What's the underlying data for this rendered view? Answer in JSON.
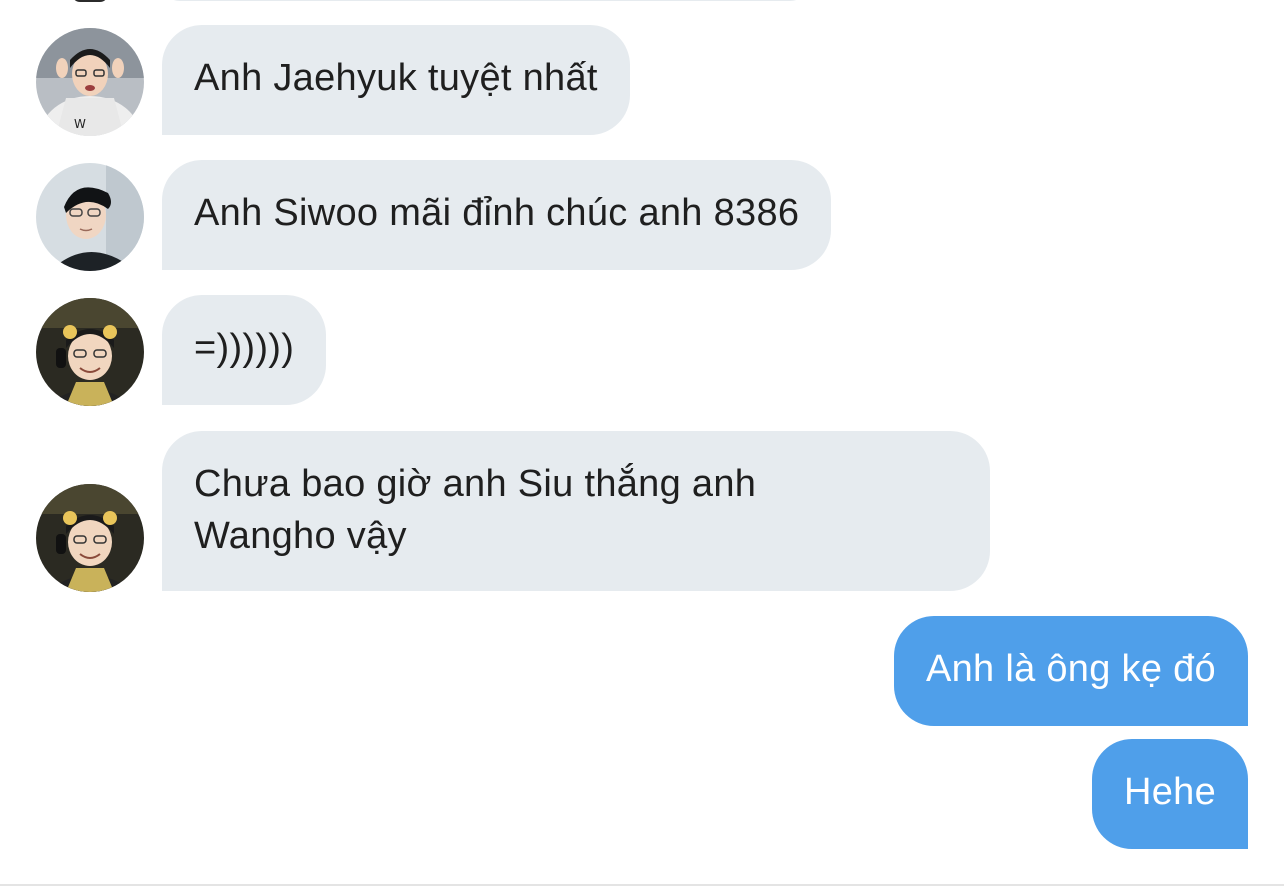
{
  "messages": [
    {
      "direction": "incoming",
      "sender_avatar": "avatar-jaehyuk",
      "text": "Anh Jaehyuk tuyệt nhất"
    },
    {
      "direction": "incoming",
      "sender_avatar": "avatar-siwoo",
      "text": "Anh Siwoo mãi đỉnh chúc anh 8386"
    },
    {
      "direction": "incoming",
      "sender_avatar": "avatar-user-3",
      "text": "=))))))"
    },
    {
      "direction": "incoming",
      "sender_avatar": "avatar-user-3",
      "text_line1": "Chưa bao giờ anh Siu thắng anh",
      "text_line2": "Wangho vậy"
    },
    {
      "direction": "outgoing",
      "text": "Anh là ông kẹ đó"
    },
    {
      "direction": "outgoing",
      "text": "Hehe"
    }
  ],
  "colors": {
    "incoming_bubble": "#e6ebef",
    "incoming_text": "#1f1f1f",
    "outgoing_bubble": "#4f9fea",
    "outgoing_text": "#ffffff",
    "background": "#ffffff"
  }
}
